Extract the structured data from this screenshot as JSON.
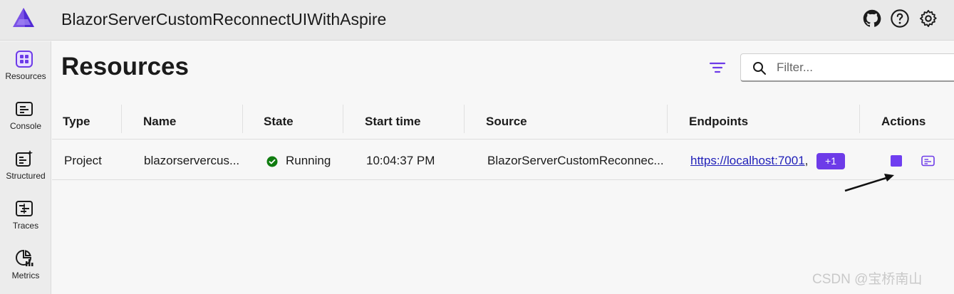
{
  "app": {
    "title": "BlazorServerCustomReconnectUIWithAspire"
  },
  "topbar": {
    "icons": [
      "github-icon",
      "help-icon",
      "settings-icon"
    ]
  },
  "sidebar": {
    "items": [
      {
        "label": "Resources",
        "icon": "resources-icon",
        "active": true
      },
      {
        "label": "Console",
        "icon": "console-icon"
      },
      {
        "label": "Structured",
        "icon": "structured-icon"
      },
      {
        "label": "Traces",
        "icon": "traces-icon"
      },
      {
        "label": "Metrics",
        "icon": "metrics-icon"
      }
    ]
  },
  "main": {
    "title": "Resources",
    "search": {
      "placeholder": "Filter...",
      "value": ""
    },
    "columns": [
      "Type",
      "Name",
      "State",
      "Start time",
      "Source",
      "Endpoints",
      "Actions"
    ],
    "rows": [
      {
        "type": "Project",
        "name": "blazorservercus...",
        "state": "Running",
        "start_time": "10:04:37 PM",
        "source": "BlazorServerCustomReconnec...",
        "endpoint": "https://localhost:7001",
        "endpoint_sep": ",",
        "more_endpoints": "+1"
      }
    ]
  },
  "colors": {
    "accent": "#6d3be8",
    "running": "#107c10",
    "link": "#1f1fb8"
  },
  "watermark": "CSDN @宝桥南山"
}
